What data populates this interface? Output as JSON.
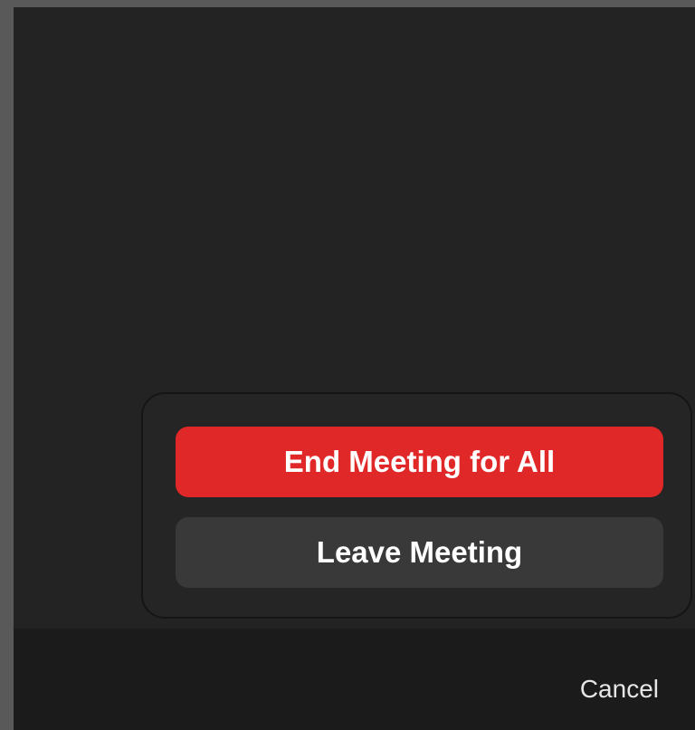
{
  "end_menu": {
    "end_for_all_label": "End Meeting for All",
    "leave_label": "Leave Meeting"
  },
  "footer": {
    "cancel_label": "Cancel"
  },
  "colors": {
    "background": "#232323",
    "danger": "#e02828",
    "secondary_button": "#393939"
  }
}
